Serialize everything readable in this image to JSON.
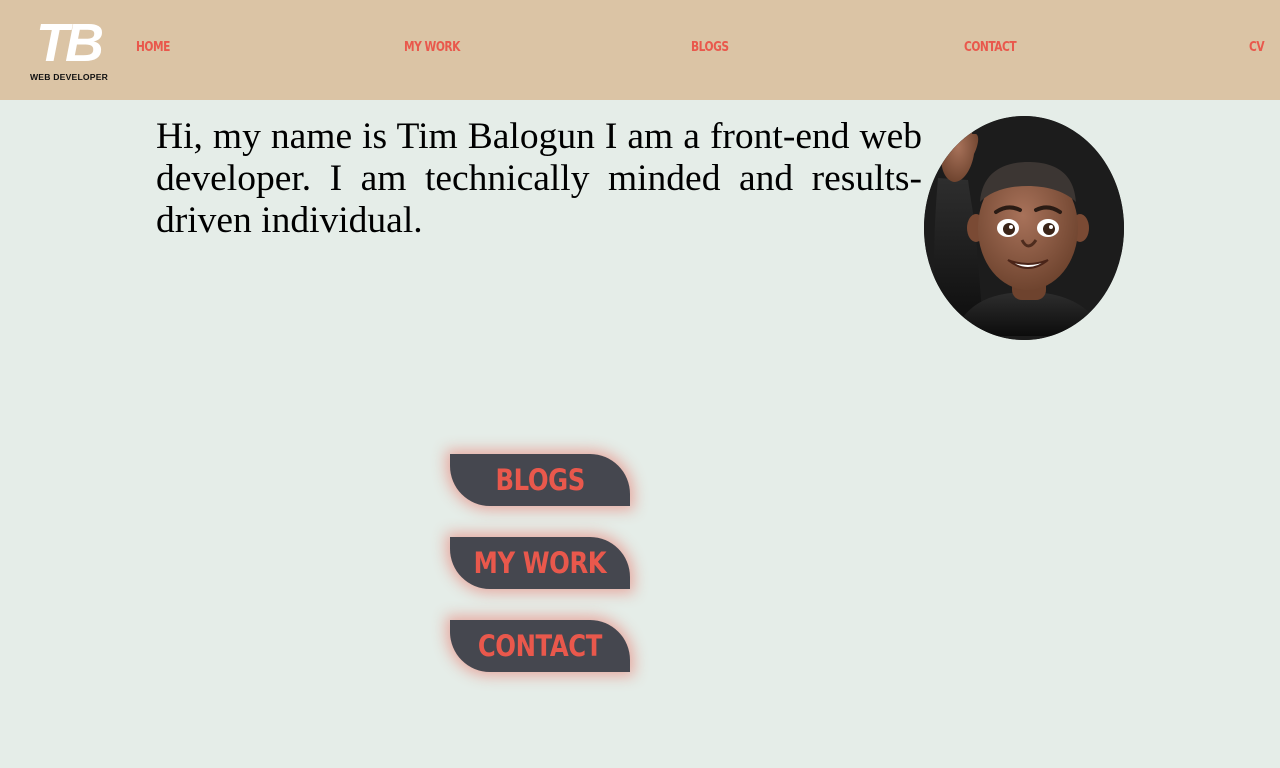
{
  "brand": {
    "logo_mark": "TB",
    "logo_subtitle": "WEB DEVELOPER"
  },
  "nav": {
    "home": "HOME",
    "my_work": "MY WORK",
    "blogs": "BLOGS",
    "contact": "CONTACT",
    "cv": "CV"
  },
  "intro": {
    "text": "Hi, my name is Tim Balogun I am a front-end web developer. I am technically minded and results-driven individual."
  },
  "avatar": {
    "icon": "waving-memoji-avatar"
  },
  "cta": {
    "blogs": "BLOGS",
    "my_work": "MY WORK",
    "contact": "CONTACT"
  },
  "colors": {
    "header_bg": "#dbc4a5",
    "page_bg": "#e5ede8",
    "accent": "#e9584c",
    "button_bg": "#45474f"
  }
}
